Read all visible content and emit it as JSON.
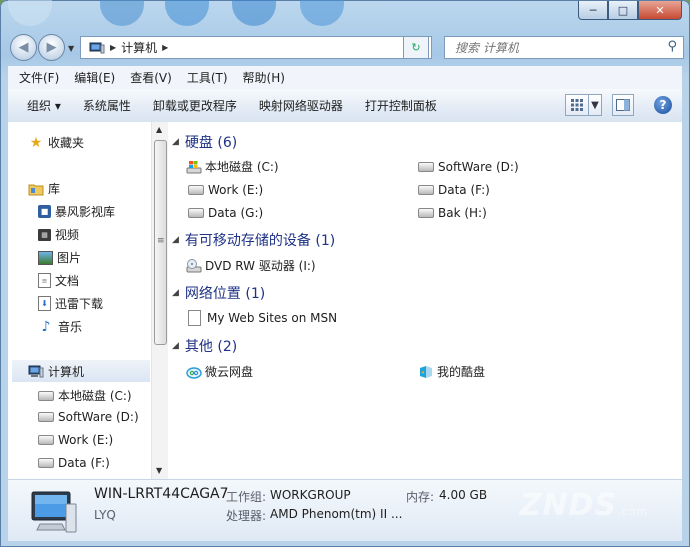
{
  "window": {
    "minimize": "─",
    "maximize": "□",
    "close": "✕"
  },
  "navigation": {
    "back": "◀",
    "forward": "▶",
    "address_crumb": "计算机",
    "search_placeholder": "搜索 计算机"
  },
  "menubar": [
    "文件(F)",
    "编辑(E)",
    "查看(V)",
    "工具(T)",
    "帮助(H)"
  ],
  "commandbar": {
    "organize": "组织 ▾",
    "system_properties": "系统属性",
    "uninstall": "卸载或更改程序",
    "map_drive": "映射网络驱动器",
    "control_panel": "打开控制面板",
    "help": "?"
  },
  "sidebar": {
    "favorites": "收藏夹",
    "libraries": "库",
    "library_items": [
      "暴风影视库",
      "视频",
      "图片",
      "文档",
      "迅雷下载",
      "音乐"
    ],
    "computer": "计算机",
    "computer_items": [
      "本地磁盘 (C:)",
      "SoftWare (D:)",
      "Work (E:)",
      "Data (F:)"
    ]
  },
  "groups": {
    "hard_disks": {
      "title": "硬盘 (6)",
      "items": [
        "本地磁盘 (C:)",
        "SoftWare (D:)",
        "Work (E:)",
        "Data (F:)",
        "Data (G:)",
        "Bak (H:)"
      ]
    },
    "removable": {
      "title": "有可移动存储的设备 (1)",
      "items": [
        "DVD RW 驱动器 (I:)"
      ]
    },
    "network": {
      "title": "网络位置 (1)",
      "items": [
        "My Web Sites on MSN"
      ]
    },
    "other": {
      "title": "其他 (2)",
      "items": [
        "微云网盘",
        "我的酷盘"
      ]
    }
  },
  "details": {
    "computer_name": "WIN-LRRT44CAGA7",
    "user": "LYQ",
    "workgroup_label": "工作组:",
    "workgroup": "WORKGROUP",
    "memory_label": "内存:",
    "memory": "4.00 GB",
    "processor_label": "处理器:",
    "processor": "AMD Phenom(tm) II ..."
  },
  "watermark": "ZNDS",
  "watermark_suffix": ".com",
  "colors": {
    "group_header": "#1e3287",
    "accent": "#3d6fae"
  },
  "icons": [
    "star-icon",
    "library-icon",
    "computer-icon",
    "hard-drive-icon",
    "dvd-drive-icon",
    "web-folder-icon",
    "cloud-icon",
    "kupan-icon",
    "search-icon",
    "refresh-icon",
    "help-icon"
  ]
}
